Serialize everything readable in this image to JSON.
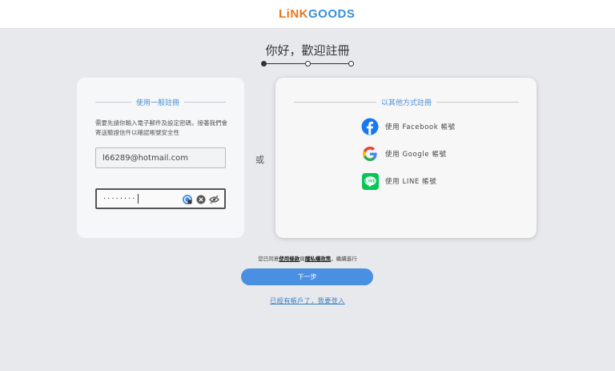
{
  "header": {
    "logo_part1": "LiNK",
    "logo_part2": "GOODS"
  },
  "page": {
    "title": "你好，歡迎註冊"
  },
  "steps": {
    "total": 3,
    "current": 1
  },
  "general": {
    "section_title": "使用一般註冊",
    "description": "需要先請你輸入電子郵件及設定密碼，接著我們會寄送驗證信件以確認帳號安全性",
    "email_value": "l66289@hotmail.com",
    "password_mask": "········"
  },
  "divider": {
    "or_label": "或"
  },
  "social": {
    "section_title": "以其他方式註冊",
    "facebook_label": "使用 Facebook 帳號",
    "google_label": "使用 Google 帳號",
    "line_label": "使用 LINE 帳號",
    "line_icon_text": "LINE"
  },
  "terms": {
    "prefix": "您已同意",
    "terms_link": "使用條款",
    "and": "與",
    "privacy_link": "隱私權政策",
    "suffix": "，繼續進行"
  },
  "actions": {
    "next_label": "下一步",
    "login_link": "已經有帳戶了，我要登入"
  },
  "colors": {
    "accent": "#4a90e2",
    "logo_orange": "#e8771f",
    "logo_blue": "#3a8fd9"
  }
}
